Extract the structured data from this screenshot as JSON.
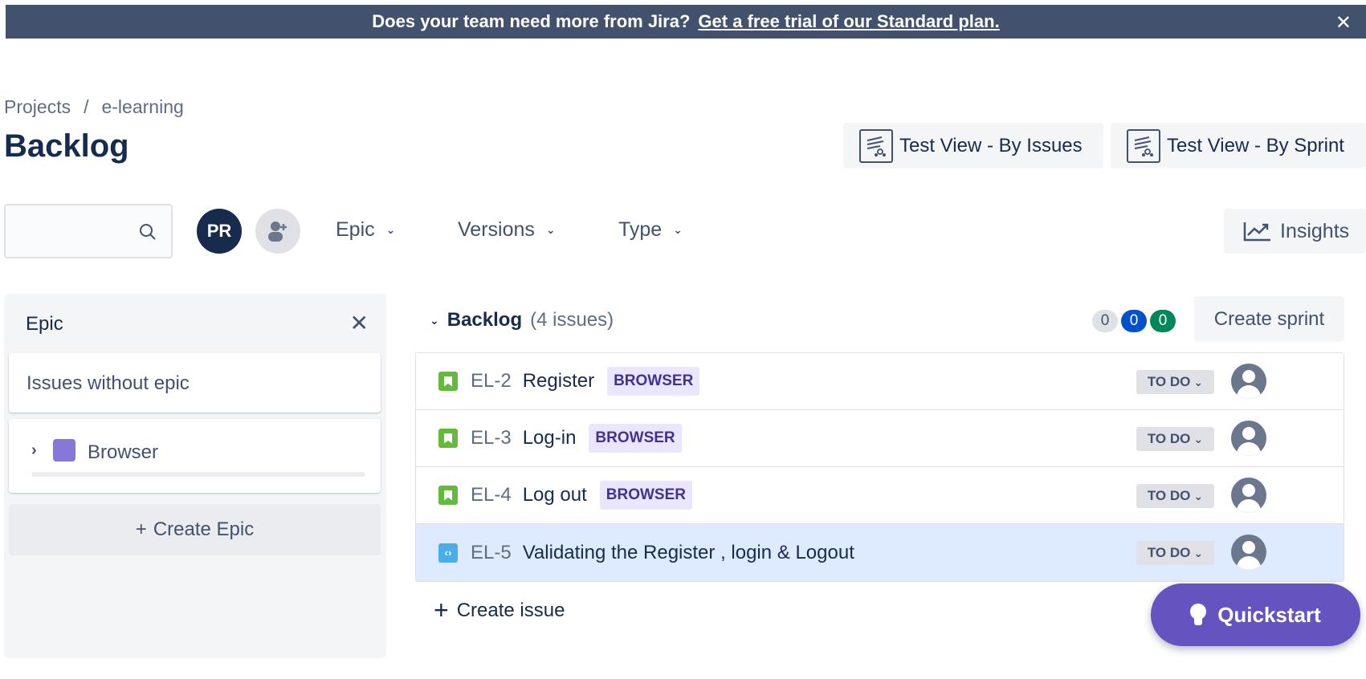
{
  "banner": {
    "text": "Does your team need more from Jira?",
    "link": "Get a free trial of our Standard plan.",
    "close": "✕"
  },
  "breadcrumb": {
    "root": "Projects",
    "separator": "/",
    "project": "e-learning"
  },
  "page_title": "Backlog",
  "header_buttons": {
    "test_view_issues": "Test View - By Issues",
    "test_view_sprint": "Test View - By Sprint"
  },
  "toolbar": {
    "search_placeholder": "",
    "avatar_initials": "PR",
    "filters": [
      "Epic",
      "Versions",
      "Type"
    ],
    "insights": "Insights"
  },
  "epic_panel": {
    "title": "Epic",
    "close": "✕",
    "issues_without_epic": "Issues without epic",
    "epics": [
      {
        "name": "Browser",
        "color": "#8777d9"
      }
    ],
    "create_epic": "Create Epic"
  },
  "backlog": {
    "title": "Backlog",
    "count_label": "(4 issues)",
    "counts": {
      "todo": "0",
      "in_progress": "0",
      "done": "0"
    },
    "create_sprint": "Create sprint",
    "issues": [
      {
        "type": "story",
        "key": "EL-2",
        "summary": "Register",
        "epic": "BROWSER",
        "status": "TO DO"
      },
      {
        "type": "story",
        "key": "EL-3",
        "summary": "Log-in",
        "epic": "BROWSER",
        "status": "TO DO"
      },
      {
        "type": "story",
        "key": "EL-4",
        "summary": "Log out",
        "epic": "BROWSER",
        "status": "TO DO"
      },
      {
        "type": "task",
        "key": "EL-5",
        "summary": "Validating the Register , login & Logout",
        "epic": "",
        "status": "TO DO"
      }
    ],
    "create_issue": "Create issue"
  },
  "quickstart": "Quickstart",
  "colors": {
    "banner": "#42526e",
    "primary_text": "#172b4d",
    "quickstart": "#6554c0",
    "epic_lozenge": "#eae6ff",
    "selected_row": "#deebff"
  }
}
